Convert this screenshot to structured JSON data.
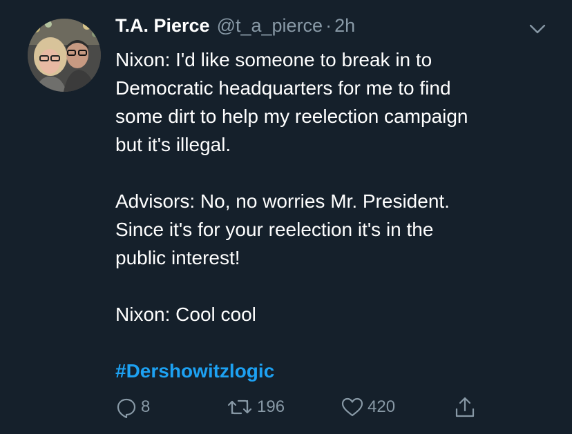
{
  "tweet": {
    "author": {
      "display_name": "T.A. Pierce",
      "handle": "@t_a_pierce",
      "separator": "·",
      "timestamp": "2h",
      "avatar_icon": "profile-photo"
    },
    "text_paragraphs": [
      "Nixon: I'd like someone to break in to\nDemocratic headquarters for me to find\nsome dirt to help my reelection campaign\nbut it's illegal.",
      "Advisors: No, no worries Mr. President.\nSince it's for your reelection it's in the\npublic interest!",
      "Nixon: Cool cool"
    ],
    "hashtag": "#Dershowitzlogic",
    "actions": {
      "reply": {
        "icon": "reply-icon",
        "count": "8"
      },
      "retweet": {
        "icon": "retweet-icon",
        "count": "196"
      },
      "like": {
        "icon": "heart-icon",
        "count": "420"
      },
      "share": {
        "icon": "share-icon"
      }
    },
    "menu_icon": "chevron-down-icon"
  },
  "colors": {
    "background": "#15202b",
    "text": "#ffffff",
    "muted": "#8899a6",
    "link": "#1da1f2"
  }
}
